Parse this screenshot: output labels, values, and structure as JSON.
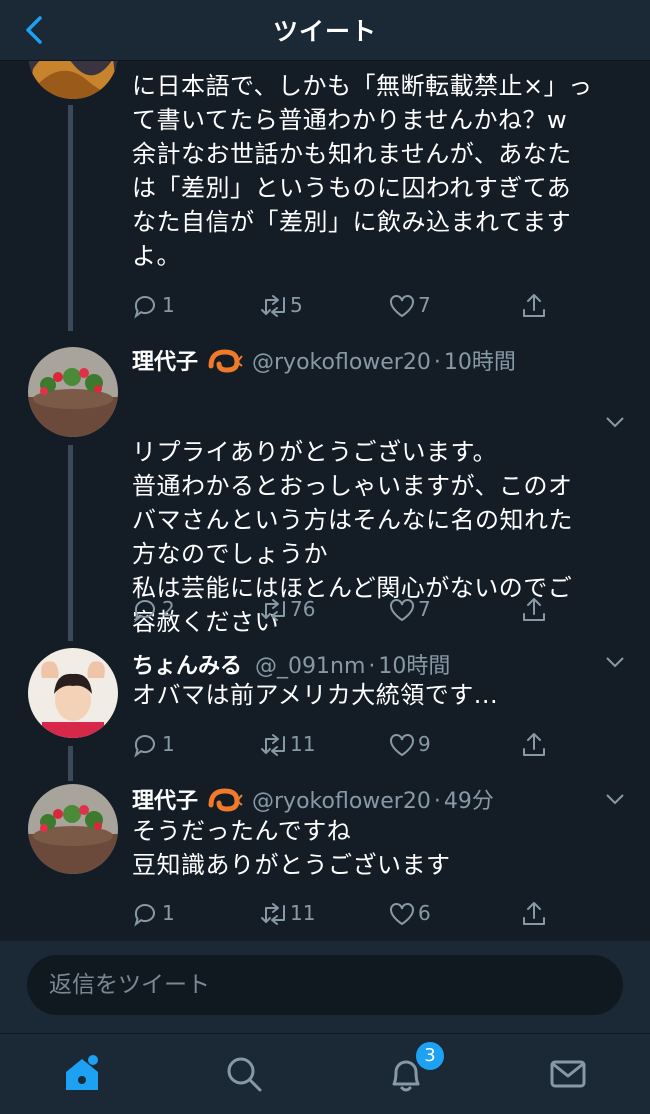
{
  "header": {
    "title": "ツイート"
  },
  "tweets": [
    {
      "lines": [
        "に日本語で、しかも「無断転載禁止×」っ",
        "て書いてたら普通わかりませんかね？w",
        "余計なお世話かも知れませんが、あなた",
        "は「差別」というものに囚われすぎてあ",
        "なた自信が「差別」に飲み込まれてます",
        "よ。"
      ],
      "replies": "1",
      "retweets": "5",
      "likes": "7"
    },
    {
      "display_name": "理代子",
      "handle": "@ryokoflower20",
      "time": "10時間",
      "lines": [
        "リプライありがとうございます。",
        "普通わかるとおっしゃいますが、このオ",
        "バマさんという方はそんなに名の知れた",
        "方なのでしょうか",
        "私は芸能にはほとんど関心がないのでご",
        "容赦ください"
      ],
      "replies": "2",
      "retweets": "76",
      "likes": "7"
    },
    {
      "display_name": "ちょんみる",
      "handle": "@_091nm",
      "time": "10時間",
      "lines": [
        "オバマは前アメリカ大統領です..."
      ],
      "replies": "1",
      "retweets": "11",
      "likes": "9"
    },
    {
      "display_name": "理代子",
      "handle": "@ryokoflower20",
      "time": "49分",
      "lines": [
        "そうだったんですね",
        "豆知識ありがとうございます"
      ],
      "replies": "1",
      "retweets": "11",
      "likes": "6"
    }
  ],
  "reply_box": {
    "placeholder": "返信をツイート"
  },
  "tabbar": {
    "notifications_badge": "3"
  },
  "icons": {
    "back": "chevron-left-icon",
    "caret": "chevron-down-icon",
    "reply": "speech-bubble-icon",
    "retweet": "retweet-icon",
    "like": "heart-icon",
    "share": "share-icon",
    "home": "home-icon",
    "search": "search-icon",
    "notifications": "bell-icon",
    "messages": "envelope-icon",
    "emoji": "shrimp-emoji-icon"
  },
  "colors": {
    "background": "#141d26",
    "bar": "#1b2836",
    "accent": "#1da1f2",
    "muted": "#8899a6",
    "text": "#ffffff"
  }
}
